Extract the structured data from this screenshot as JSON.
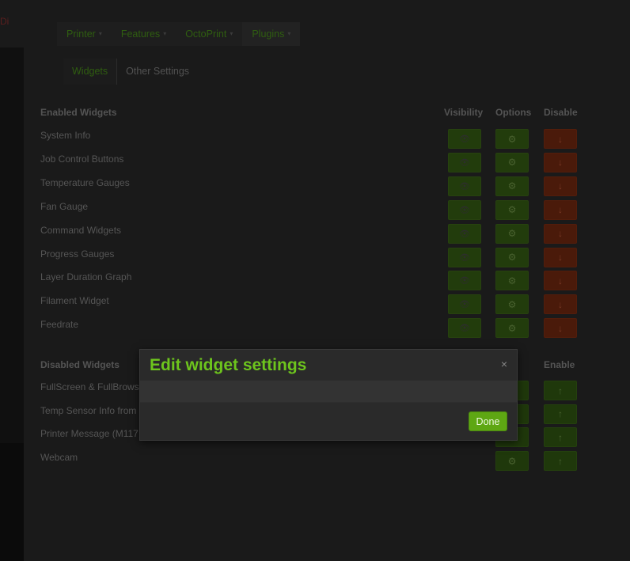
{
  "sidebar_cut_text": "Di",
  "menu": [
    {
      "label": "Printer"
    },
    {
      "label": "Features"
    },
    {
      "label": "OctoPrint"
    },
    {
      "label": "Plugins"
    }
  ],
  "tabs": [
    {
      "label": "Widgets"
    },
    {
      "label": "Other Settings"
    }
  ],
  "enabled": {
    "title": "Enabled Widgets",
    "col_visibility": "Visibility",
    "col_options": "Options",
    "col_disable": "Disable",
    "rows": [
      "System Info",
      "Job Control Buttons",
      "Temperature Gauges",
      "Fan Gauge",
      "Command Widgets",
      "Progress Gauges",
      "Layer Duration Graph",
      "Filament Widget",
      "Feedrate"
    ]
  },
  "disabled": {
    "title": "Disabled Widgets",
    "col_enable": "Enable",
    "rows": [
      "FullScreen & FullBrows",
      "Temp Sensor Info from",
      "Printer Message (M117",
      "Webcam"
    ]
  },
  "modal": {
    "title": "Edit widget settings",
    "close": "×",
    "done_label": "Done"
  },
  "icons": {
    "eye": "👁",
    "gear": "⚙",
    "arrow_down": "↓",
    "arrow_up": "↑",
    "caret": "▾"
  },
  "colors": {
    "accent": "#6dc51d",
    "done_button": "#5ea713",
    "enabled_button": "#223c0c",
    "disable_button": "#4a1a0a"
  }
}
